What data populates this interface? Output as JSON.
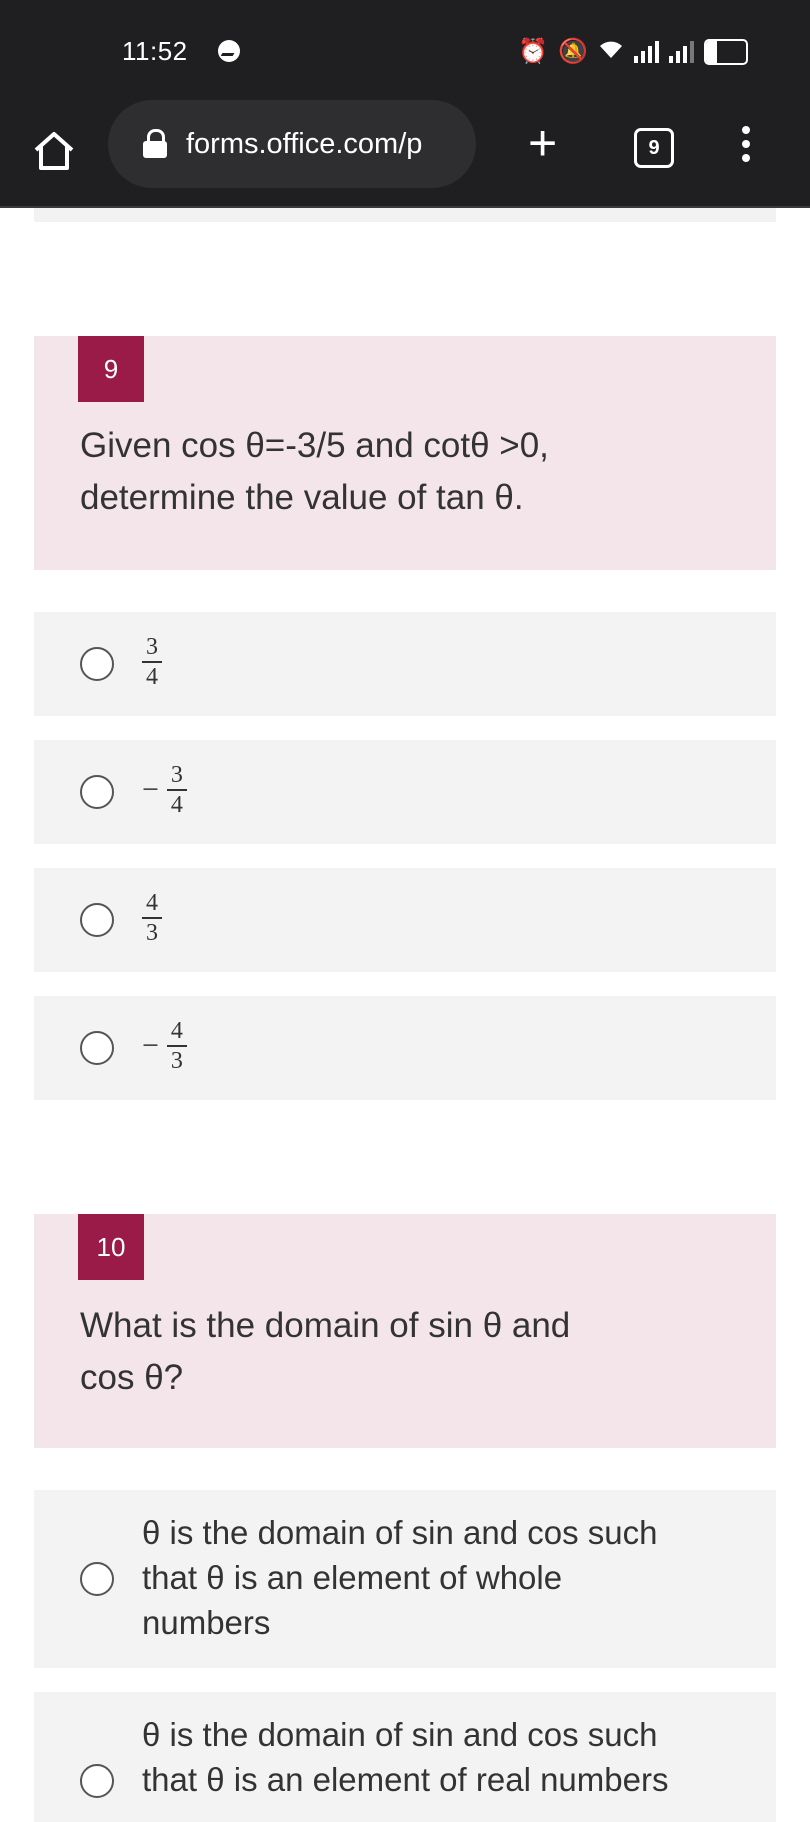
{
  "status_bar": {
    "time": "11:52",
    "battery": "28"
  },
  "browser": {
    "url": "forms.office.com/p",
    "tab_count": "9"
  },
  "questions": [
    {
      "number": "9",
      "text_line1": "Given cos θ=-3/5  and  cotθ >0,",
      "text_line2": "determine the value of tan θ.",
      "options": [
        {
          "sign": "",
          "numerator": "3",
          "denominator": "4"
        },
        {
          "sign": "−",
          "numerator": "3",
          "denominator": "4"
        },
        {
          "sign": "",
          "numerator": "4",
          "denominator": "3"
        },
        {
          "sign": "−",
          "numerator": "4",
          "denominator": "3"
        }
      ]
    },
    {
      "number": "10",
      "text_line1": "What is the domain of sin θ and",
      "text_line2": "cos θ?",
      "options": [
        {
          "line1": "θ is the domain of sin and cos such",
          "line2": "that θ is an element of whole",
          "line3": "numbers"
        },
        {
          "line1": "θ is the domain of sin and cos such",
          "line2": "that θ is an element of real numbers"
        }
      ]
    }
  ],
  "colors": {
    "accent": "#9b1b48",
    "question_bg": "#f3e5ea",
    "option_bg": "#f3f3f3",
    "chrome_bg": "#1f1f21"
  }
}
